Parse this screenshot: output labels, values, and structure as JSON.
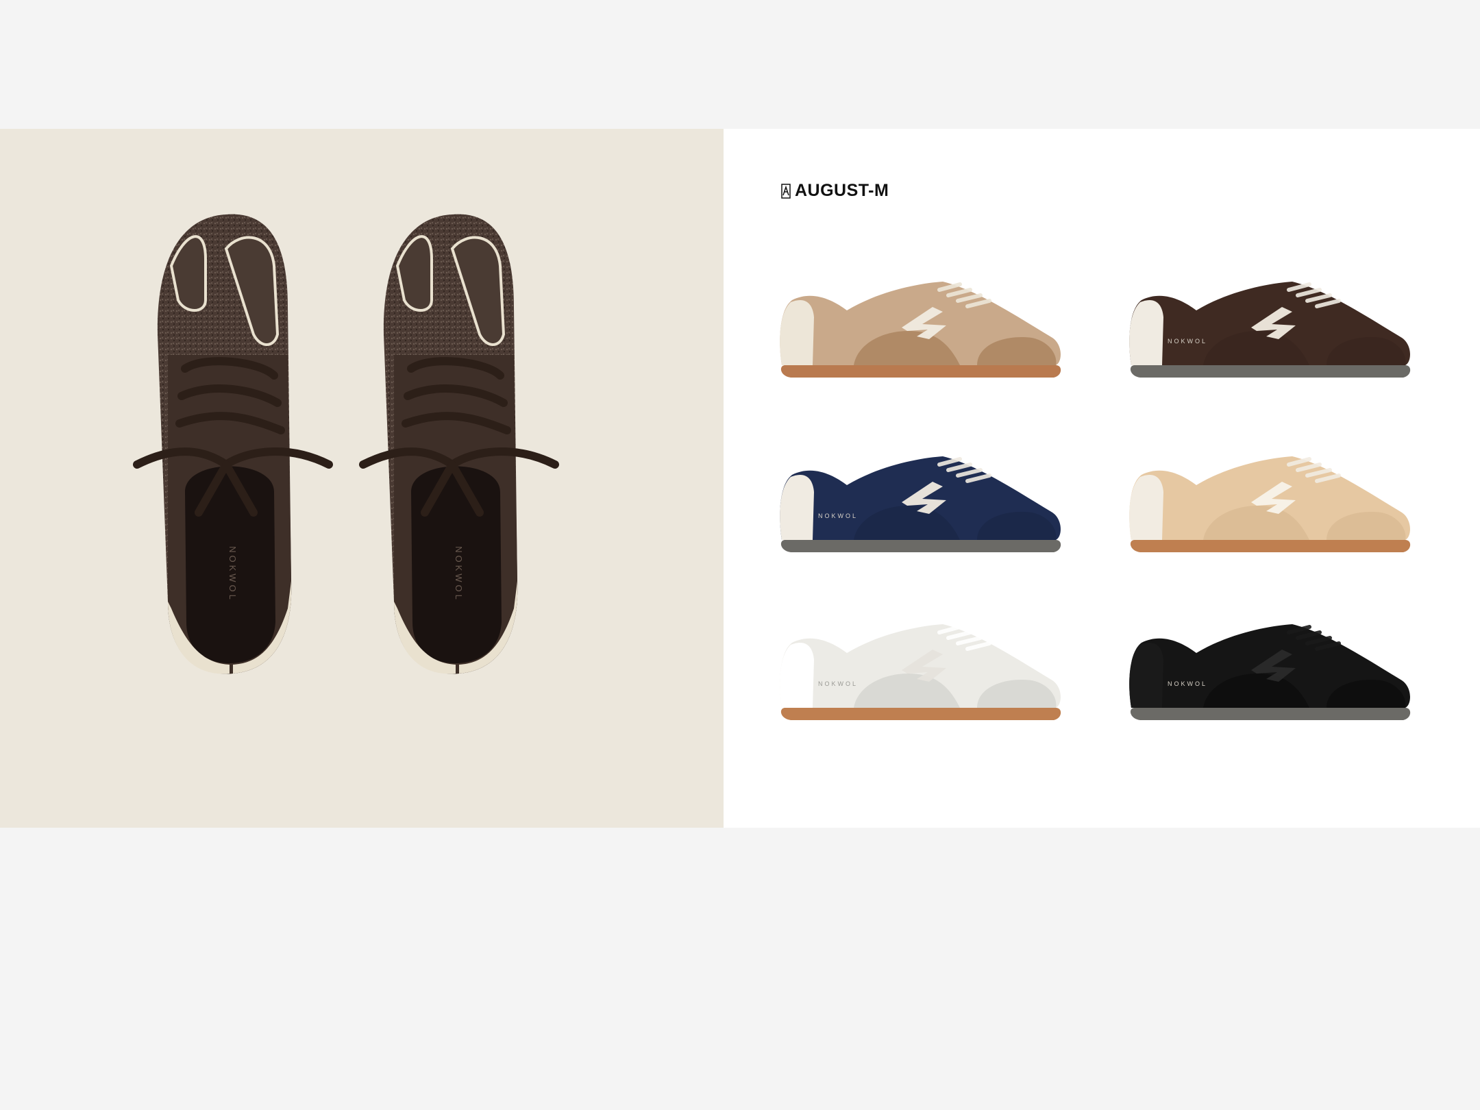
{
  "brand": {
    "name": "AUGUST-M",
    "mark": "AM"
  },
  "hero": {
    "insole_text": "NOKWOL",
    "background": "#ece7dc",
    "upper_color": "#3e2f28",
    "trim_color": "#e9e1cf"
  },
  "products": [
    {
      "name": "sneaker-tan-suede",
      "print": "",
      "upper": "#c9a98a",
      "overlay": "#b08a66",
      "sole": "#b97a4f",
      "heel": "#ede6d8",
      "logo": "#f1ebe0"
    },
    {
      "name": "sneaker-brown-suede",
      "print": "NOKWOL",
      "upper": "#3f2a22",
      "overlay": "#3a261f",
      "sole": "#6b6a66",
      "heel": "#f0ebe2",
      "logo": "#f1ebe0"
    },
    {
      "name": "sneaker-navy-suede",
      "print": "NOKWOL",
      "upper": "#1f2d52",
      "overlay": "#1b2849",
      "sole": "#6b6a66",
      "heel": "#f0ebe2",
      "logo": "#f1ebe0"
    },
    {
      "name": "sneaker-beige-suede",
      "print": "",
      "upper": "#e6c8a2",
      "overlay": "#dcbd96",
      "sole": "#bf7f50",
      "heel": "#f2ece2",
      "logo": "#f8f3ea"
    },
    {
      "name": "sneaker-white-leather",
      "print": "NOKWOL",
      "upper": "#ecebe6",
      "overlay": "#d9d9d4",
      "sole": "#bf7f50",
      "heel": "#ffffff",
      "logo": "#e6e3dc"
    },
    {
      "name": "sneaker-black-leather",
      "print": "NOKWOL",
      "upper": "#151515",
      "overlay": "#0e0e0e",
      "sole": "#6b6a66",
      "heel": "#1a1a1a",
      "logo": "#2a2a2a"
    }
  ]
}
